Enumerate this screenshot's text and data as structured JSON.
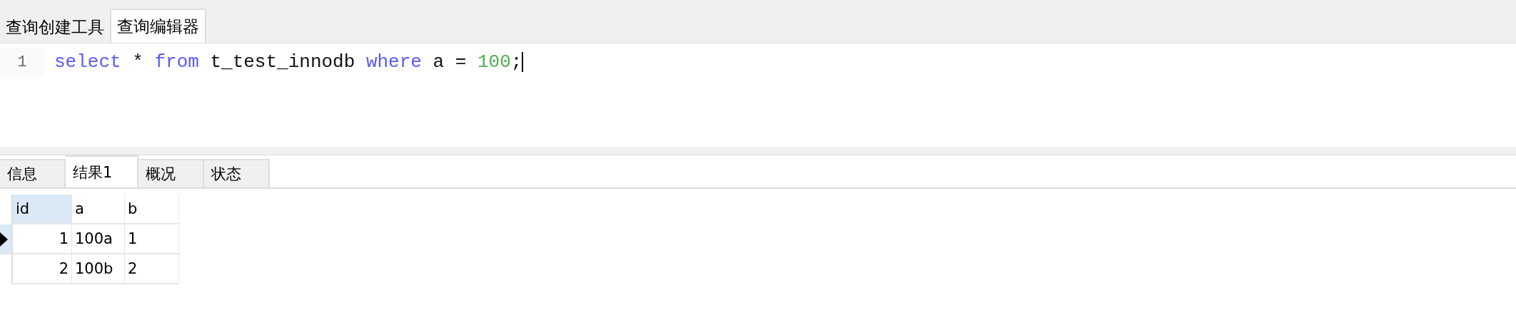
{
  "editor_tabs": [
    {
      "label": "查询创建工具",
      "selected": false
    },
    {
      "label": "查询编辑器",
      "selected": true
    }
  ],
  "editor": {
    "lines": [
      {
        "number": "1",
        "tokens": [
          {
            "kind": "keyword",
            "text": "select"
          },
          {
            "kind": "plain",
            "text": " * "
          },
          {
            "kind": "keyword",
            "text": "from"
          },
          {
            "kind": "plain",
            "text": " t_test_innodb "
          },
          {
            "kind": "keyword",
            "text": "where"
          },
          {
            "kind": "plain",
            "text": " a = "
          },
          {
            "kind": "number",
            "text": "100"
          },
          {
            "kind": "plain",
            "text": ";"
          }
        ],
        "caret": true
      }
    ]
  },
  "result_tabs": [
    {
      "label": "信息",
      "selected": false
    },
    {
      "label": "结果1",
      "selected": true
    },
    {
      "label": "概况",
      "selected": false
    },
    {
      "label": "状态",
      "selected": false
    }
  ],
  "table": {
    "columns": [
      {
        "label": "id",
        "selected": true
      },
      {
        "label": "a",
        "selected": false
      },
      {
        "label": "b",
        "selected": false
      }
    ],
    "rows": [
      {
        "selected": true,
        "cells": [
          "1",
          "100a",
          "1"
        ]
      },
      {
        "selected": false,
        "cells": [
          "2",
          "100b",
          "2"
        ]
      }
    ]
  }
}
